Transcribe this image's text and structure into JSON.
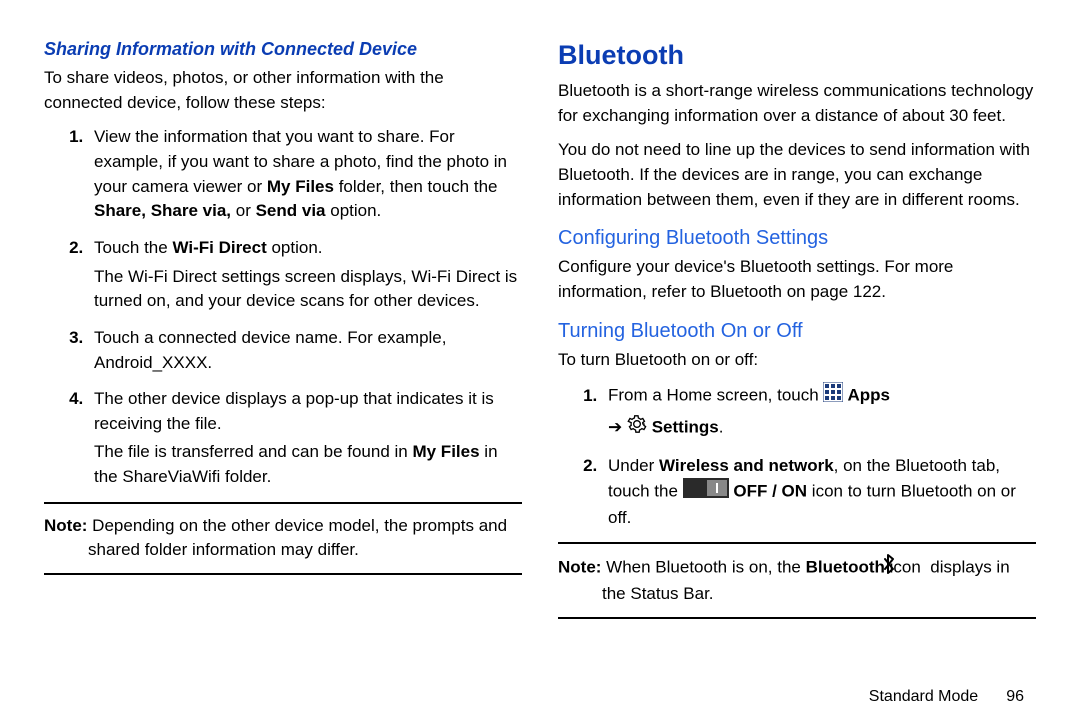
{
  "left": {
    "heading": "Sharing Information with Connected Device",
    "intro": "To share videos, photos, or other information with the connected device, follow these steps:",
    "step1_a": "View the information that you want to share. For example, if you want to share a photo, find the photo in your camera viewer or ",
    "step1_myfiles": "My Files",
    "step1_b": " folder, then touch the ",
    "step1_share": "Share, Share via,",
    "step1_c": " or ",
    "step1_sendvia": "Send via",
    "step1_d": " option.",
    "step2_a": "Touch the ",
    "step2_wifi": "Wi-Fi Direct",
    "step2_b": " option.",
    "step2_sub": "The Wi-Fi Direct settings screen displays, Wi-Fi Direct is turned on, and your device scans for other devices.",
    "step3": "Touch a connected device name. For example, Android_XXXX.",
    "step4_a": "The other device displays a pop-up that indicates it is receiving the file.",
    "step4_sub_a": "The file is transferred and can be found in ",
    "step4_sub_myfiles": "My Files",
    "step4_sub_b": " in the ShareViaWifi folder.",
    "note_label": "Note: ",
    "note_body": "Depending on the other device model, the prompts and shared folder information may differ."
  },
  "right": {
    "heading": "Bluetooth",
    "intro1": "Bluetooth is a short-range wireless communications technology for exchanging information over a distance of about 30 feet.",
    "intro2": "You do not need to line up the devices to send information with Bluetooth. If the devices are in range, you can exchange information between them, even if they are in different rooms.",
    "h4a": "Configuring Bluetooth Settings",
    "conf_a": "Configure your device's Bluetooth settings. For more information, refer to  ",
    "conf_link": "Bluetooth",
    "conf_b": " on page 122.",
    "h4b": "Turning Bluetooth On or Off",
    "turn_intro": "To turn Bluetooth on or off:",
    "step1_a": "From a Home screen, touch ",
    "step1_apps": " Apps",
    "step1_arrow": " ➔ ",
    "step1_settings": "Settings",
    "step1_end": ".",
    "step2_a": "Under ",
    "step2_wn": "Wireless and network",
    "step2_b": ", on the Bluetooth tab, touch the ",
    "step2_offon": " OFF / ON",
    "step2_c": " icon to turn Bluetooth on or off.",
    "note_label": "Note: ",
    "note_a": "When Bluetooth is on, the ",
    "note_bt": "Bluetooth",
    "note_b": " icon ",
    "note_c": " displays in the Status Bar."
  },
  "footer": {
    "section": "Standard Mode",
    "page": "96"
  }
}
